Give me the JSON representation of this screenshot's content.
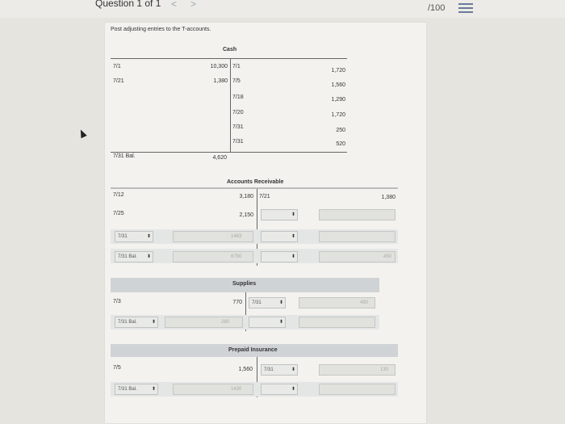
{
  "header": {
    "question_label": "Question 1 of 1",
    "prev_glyph": "<",
    "next_glyph": ">",
    "score": "/100"
  },
  "instructions": "Post adjusting entries to the T-accounts.",
  "cash": {
    "title": "Cash",
    "left_dates": [
      "7/1",
      "7/21"
    ],
    "left_amounts": [
      "10,300",
      "1,380"
    ],
    "right_dates": [
      "7/1",
      "7/5",
      "7/18",
      "7/20",
      "7/31",
      "7/31"
    ],
    "right_amounts": [
      "1,720",
      "1,560",
      "1,290",
      "1,720",
      "250",
      "520"
    ],
    "bal_label": "7/31 Bal.",
    "bal_amount": "4,620"
  },
  "ar": {
    "title": "Accounts Receivable",
    "left_dates": [
      "7/12",
      "7/25"
    ],
    "left_amounts": [
      "3,180",
      "2,150"
    ],
    "right_date": "7/21",
    "right_amount": "1,380",
    "adj_select": "7/31",
    "adj_input": "1463",
    "bal_select": "7/31 Bal.",
    "bal_input": "6790",
    "right_input_hint": "450"
  },
  "supplies": {
    "title": "Supplies",
    "left_date": "7/3",
    "left_amount": "770",
    "right_select": "7/31",
    "right_input_hint": "490",
    "bal_select": "7/31 Bal.",
    "bal_input": "280"
  },
  "prepaid": {
    "title": "Prepaid Insurance",
    "left_date": "7/5",
    "left_amount": "1,560",
    "right_select": "7/31",
    "right_input_hint": "130",
    "bal_select": "7/31 Bal.",
    "bal_input": "1430"
  }
}
